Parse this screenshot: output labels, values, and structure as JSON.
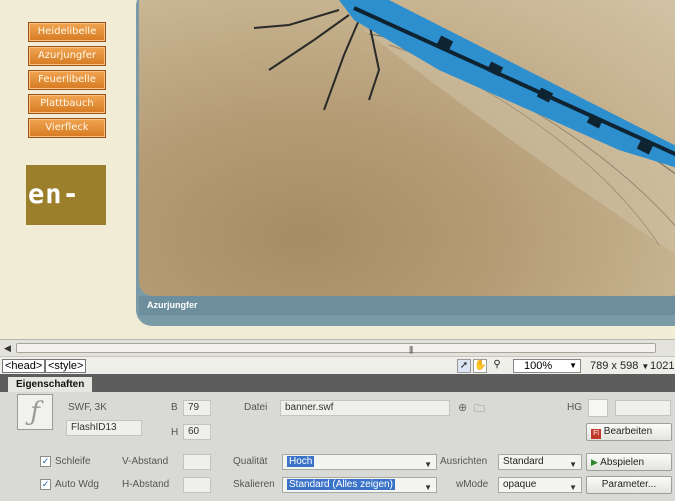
{
  "nav": {
    "items": [
      "Heidelibelle",
      "Azurjungfer",
      "Feuerlibelle",
      "Plattbauch",
      "Vierfleck"
    ]
  },
  "logo": {
    "text": "en-"
  },
  "caption": "Azurjungfer",
  "scroll": {
    "grip": "|||"
  },
  "status": {
    "tags": [
      "<head>",
      "<style>"
    ],
    "zoom": "100%",
    "size": "789 x 598",
    "extra": "1021"
  },
  "props": {
    "tab": "Eigenschaften",
    "type": "SWF, 3K",
    "id": "FlashID13",
    "width_label": "B",
    "width_value": "79",
    "height_label": "H",
    "height_value": "60",
    "file_label": "Datei",
    "file_value": "banner.swf",
    "bg_label": "HG",
    "edit_button": "Bearbeiten",
    "loop_label": "Schleife",
    "autoplay_label": "Auto Wdg",
    "vspace_label": "V-Abstand",
    "hspace_label": "H-Abstand",
    "quality_label": "Qualität",
    "quality_value": "Hoch",
    "scale_label": "Skalieren",
    "scale_value": "Standard (Alles zeigen)",
    "align_label": "Ausrichten",
    "align_value": "Standard",
    "wmode_label": "wMode",
    "wmode_value": "opaque",
    "play_button": "Abspielen",
    "params_button": "Parameter..."
  }
}
